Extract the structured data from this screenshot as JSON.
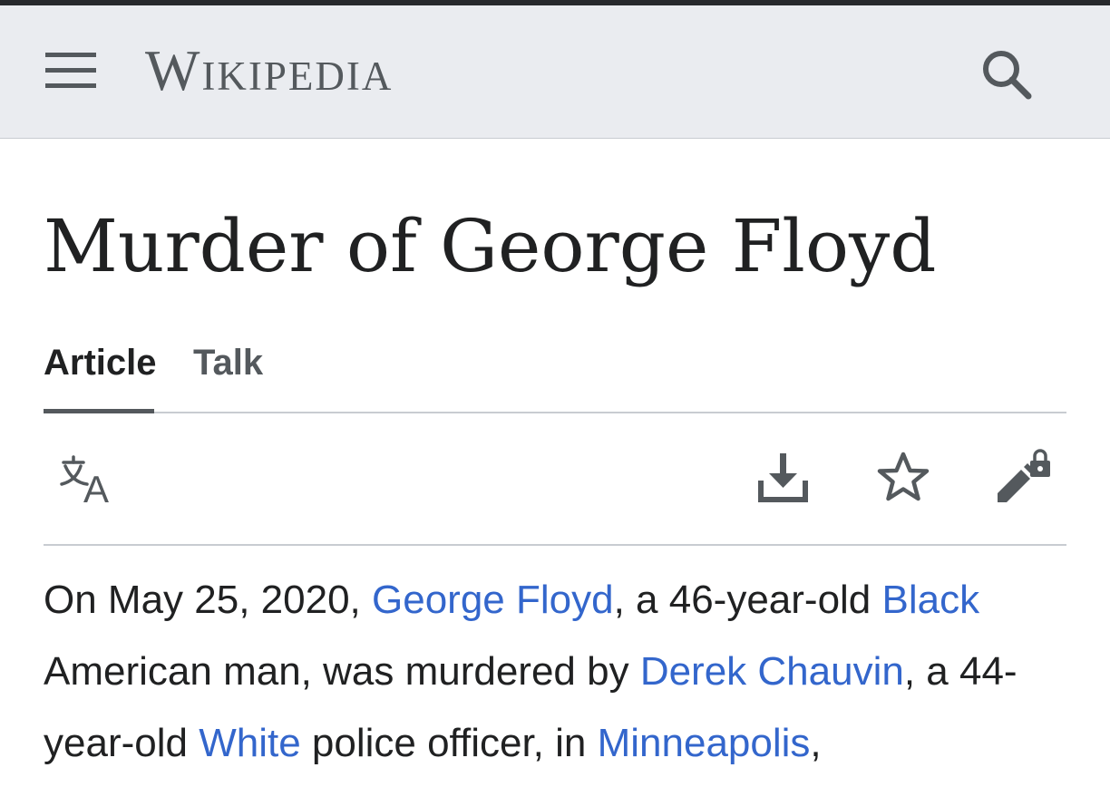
{
  "header": {
    "wordmark": "Wikipedia",
    "menu_icon": "hamburger-menu-icon",
    "search_icon": "search-icon"
  },
  "article": {
    "title": "Murder of George Floyd"
  },
  "tabs": [
    {
      "label": "Article",
      "active": true
    },
    {
      "label": "Talk",
      "active": false
    }
  ],
  "toolbar": {
    "language_icon": "language-icon",
    "download_icon": "download-icon",
    "watch_icon": "star-icon",
    "edit_icon": "edit-lock-icon"
  },
  "content": {
    "p1": "On May 25, 2020, ",
    "link_george_floyd": "George Floyd",
    "p2": ", a 46-year-old ",
    "link_black": "Black",
    "p3": " American man, was murdered by ",
    "link_derek_chauvin": "Derek Chauvin",
    "p4": ", a 44-year-old ",
    "link_white": "White",
    "p5": " police officer, in ",
    "link_minneapolis": "Minneapolis",
    "p6": ","
  },
  "colors": {
    "header_bg": "#eaecf0",
    "link": "#3366cc",
    "text": "#202122",
    "icon": "#54595d",
    "top_bar": "#27292d"
  }
}
